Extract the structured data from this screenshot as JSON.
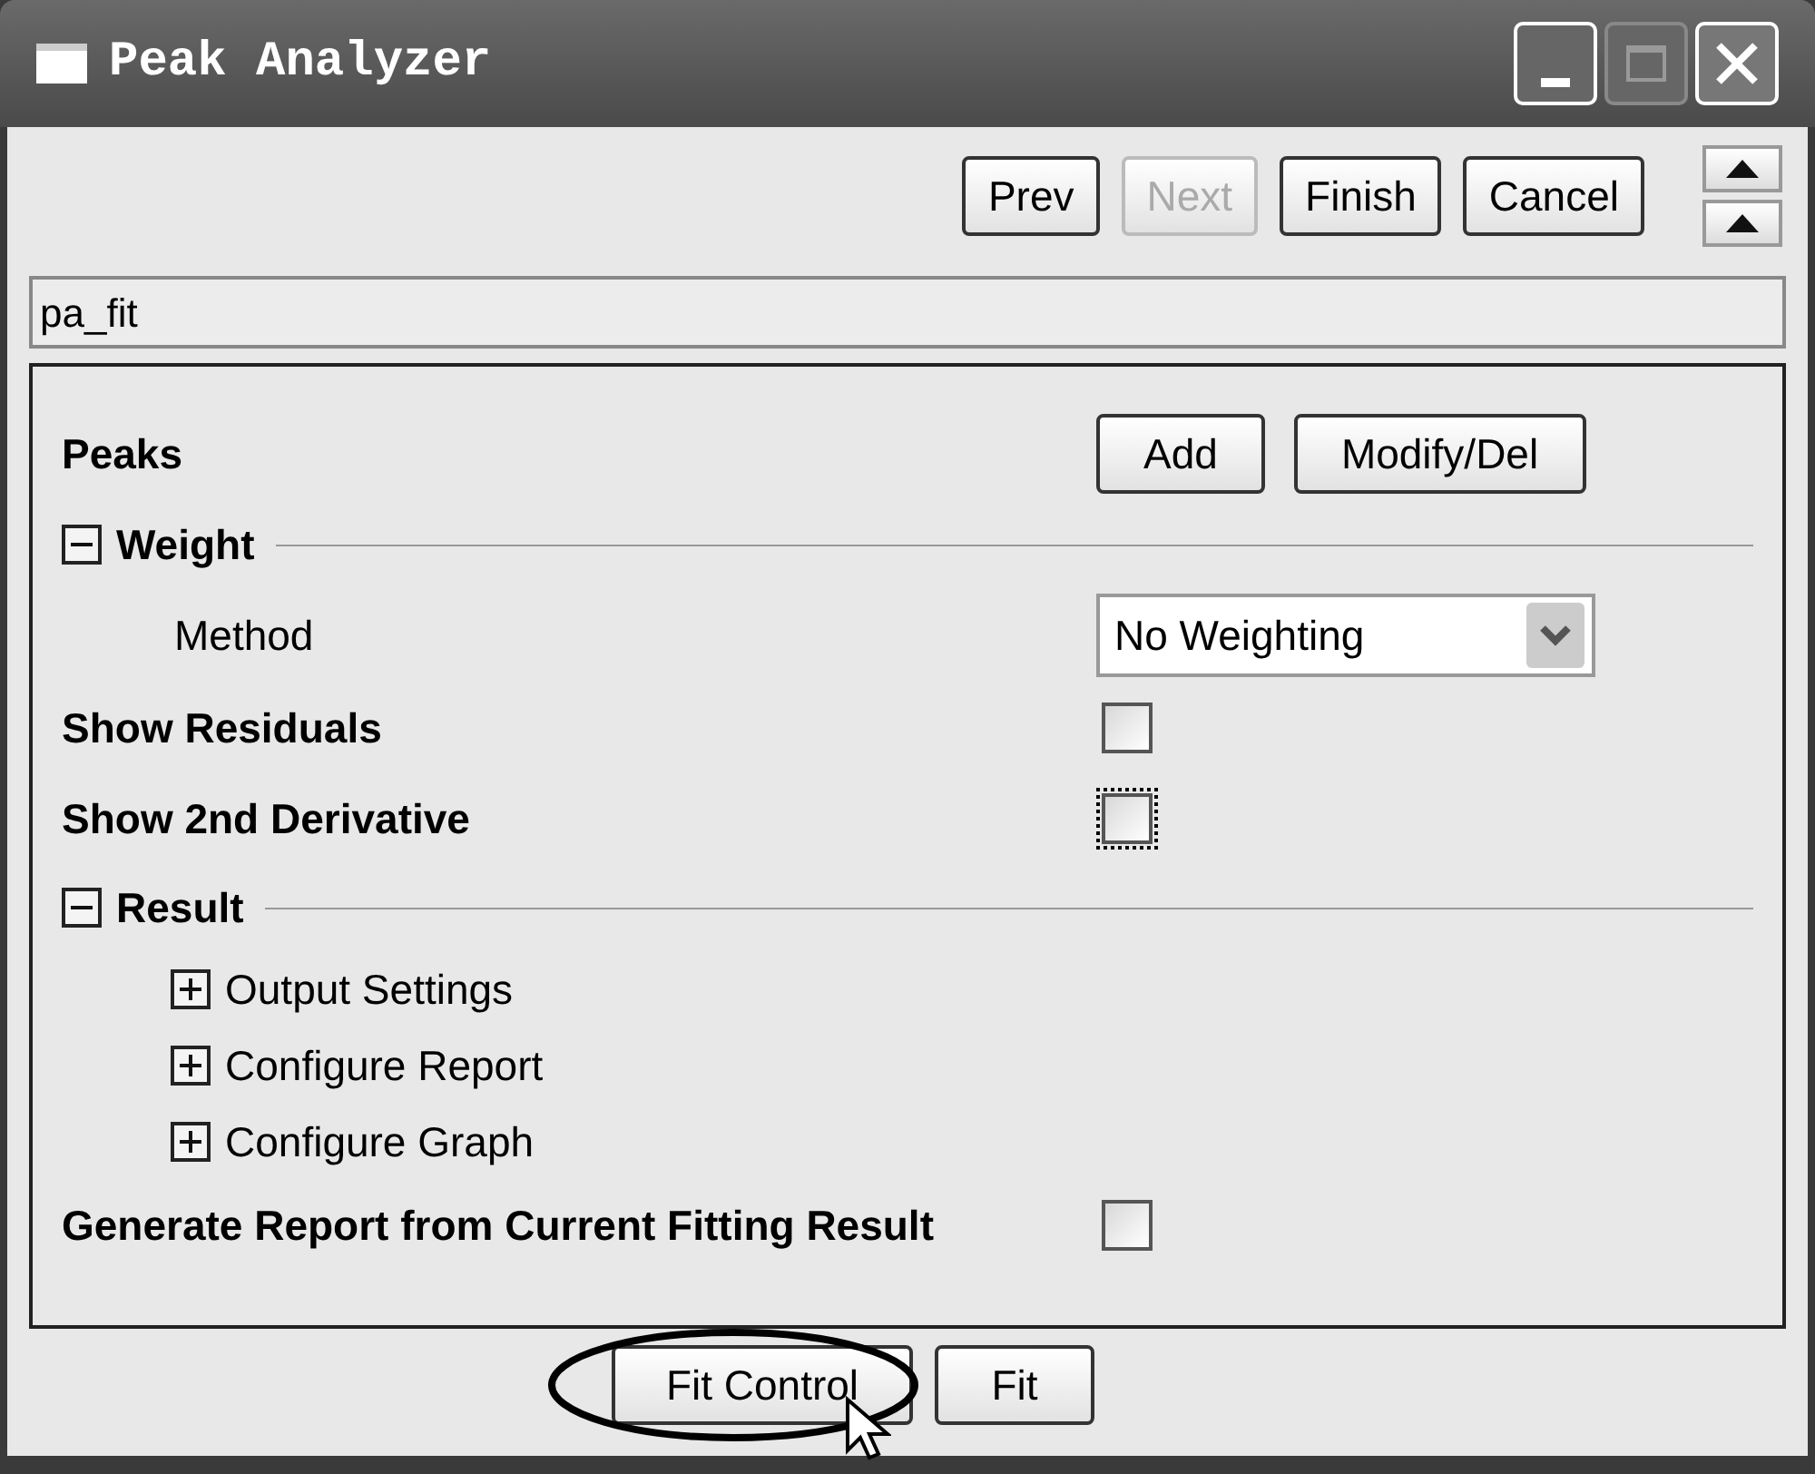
{
  "window": {
    "title": "Peak Analyzer"
  },
  "nav_buttons": [
    {
      "label": "Prev",
      "disabled": false
    },
    {
      "label": "Next",
      "disabled": true
    },
    {
      "label": "Finish",
      "disabled": false
    },
    {
      "label": "Cancel",
      "disabled": false
    }
  ],
  "page_name": {
    "value": "pa_fit"
  },
  "settings": [
    {
      "kind": "buttons",
      "label": "Peaks",
      "buttons": [
        "Add",
        "Modify/Del"
      ]
    },
    {
      "kind": "section",
      "label": "Weight",
      "expanded": true,
      "children": [
        {
          "kind": "dropdown",
          "label": "Method",
          "value": "No Weighting"
        }
      ]
    },
    {
      "kind": "checkbox",
      "label": "Show Residuals",
      "checked": false,
      "focused": false
    },
    {
      "kind": "checkbox",
      "label": "Show 2nd Derivative",
      "checked": false,
      "focused": true
    },
    {
      "kind": "section",
      "label": "Result",
      "expanded": true,
      "children": [
        {
          "kind": "node",
          "label": "Output Settings",
          "expanded": false
        },
        {
          "kind": "node",
          "label": "Configure Report",
          "expanded": false
        },
        {
          "kind": "node",
          "label": "Configure Graph",
          "expanded": false
        }
      ]
    },
    {
      "kind": "checkbox",
      "label": "Generate Report from Current Fitting Result",
      "checked": false,
      "focused": false
    }
  ],
  "bottom_buttons": [
    {
      "label": "Fit Control",
      "circled": true
    },
    {
      "label": "Fit",
      "circled": false
    }
  ]
}
